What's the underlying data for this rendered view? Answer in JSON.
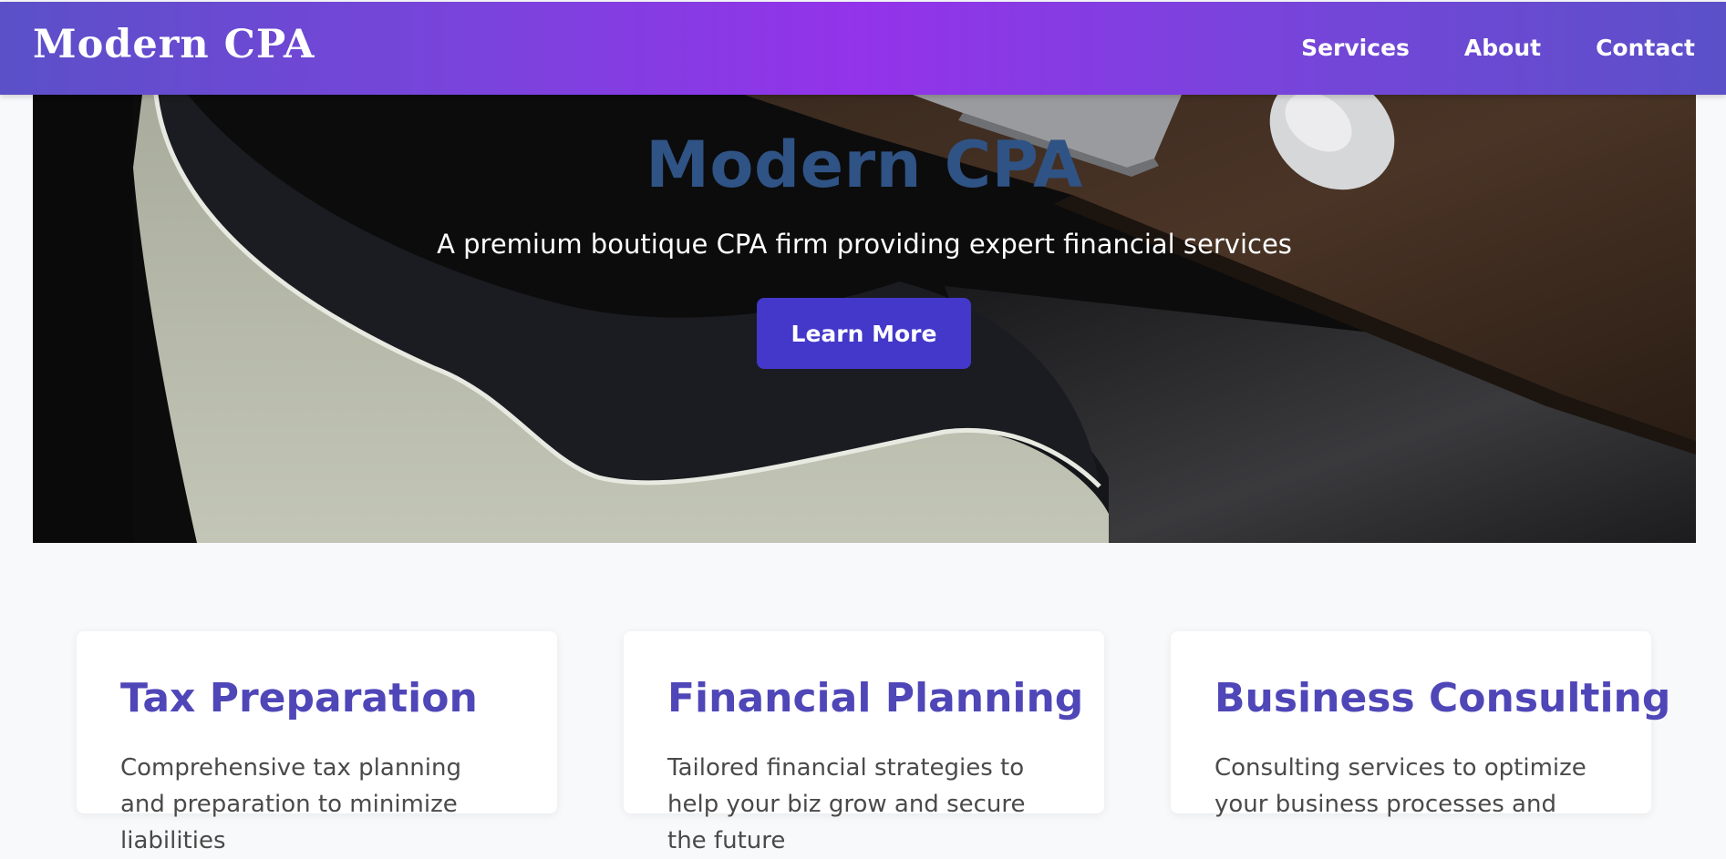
{
  "header": {
    "brand": "Modern CPA",
    "nav": [
      "Services",
      "About",
      "Contact"
    ]
  },
  "hero": {
    "title": "Modern CPA",
    "subtitle": "A premium boutique CPA firm providing expert financial services",
    "cta_label": "Learn More"
  },
  "services": [
    {
      "title": "Tax Preparation",
      "description": "Comprehensive tax planning and preparation to minimize liabilities"
    },
    {
      "title": "Financial Planning",
      "description": "Tailored financial strategies to help your biz grow and secure the future"
    },
    {
      "title": "Business Consulting",
      "description": "Consulting services to optimize your business processes and"
    }
  ],
  "colors": {
    "header_gradient_start": "#5b50c8",
    "header_gradient_mid": "#9333ea",
    "cta_background": "#4338ca",
    "hero_title": "#2f5384",
    "card_title": "#4f46b8",
    "page_background": "#f8f9fb"
  }
}
